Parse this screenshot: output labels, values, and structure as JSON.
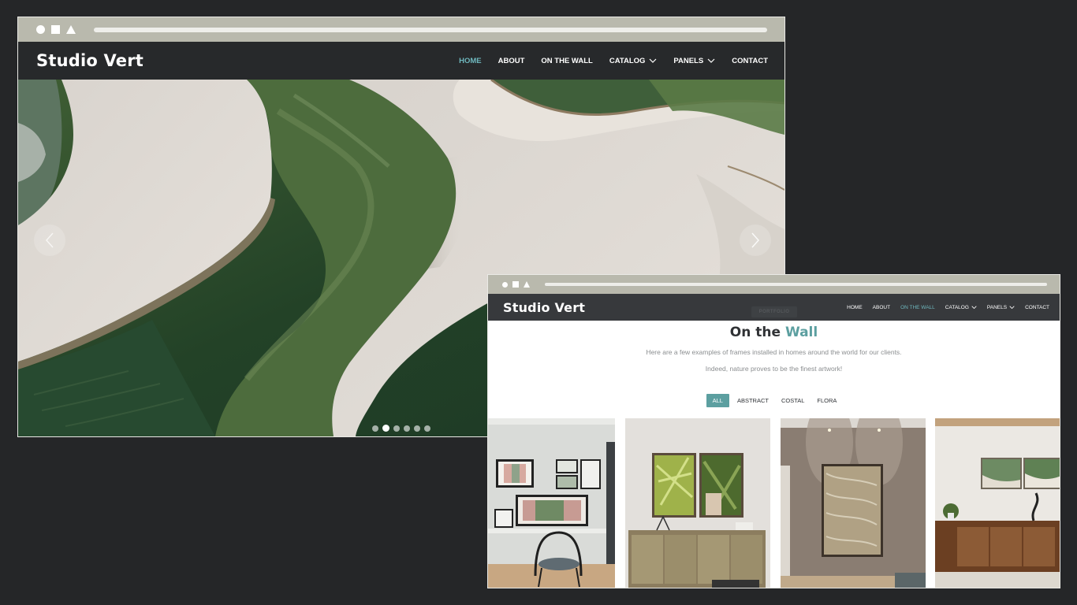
{
  "windows": {
    "home": {
      "site": {
        "logo": "Studio Vert",
        "nav": [
          {
            "label": "HOME",
            "active": true,
            "dropdown": false
          },
          {
            "label": "ABOUT",
            "active": false,
            "dropdown": false
          },
          {
            "label": "ON THE WALL",
            "active": false,
            "dropdown": false
          },
          {
            "label": "CATALOG",
            "active": false,
            "dropdown": true
          },
          {
            "label": "PANELS",
            "active": false,
            "dropdown": true
          },
          {
            "label": "CONTACT",
            "active": false,
            "dropdown": false
          }
        ]
      },
      "hero": {
        "prev_icon": "chevron-left-icon",
        "next_icon": "chevron-right-icon",
        "slide_count": 6,
        "active_slide": 2
      }
    },
    "wall": {
      "site": {
        "logo": "Studio Vert",
        "nav": [
          {
            "label": "HOME",
            "active": false,
            "dropdown": false
          },
          {
            "label": "ABOUT",
            "active": false,
            "dropdown": false
          },
          {
            "label": "ON THE WALL",
            "active": true,
            "dropdown": false
          },
          {
            "label": "CATALOG",
            "active": false,
            "dropdown": true
          },
          {
            "label": "PANELS",
            "active": false,
            "dropdown": true
          },
          {
            "label": "CONTACT",
            "active": false,
            "dropdown": false
          }
        ]
      },
      "section": {
        "tag": "PORTFOLIO",
        "title_lead": "On the",
        "title_accent": "Wall",
        "description_line1": "Here are a few examples of frames installed in homes around the world for our clients.",
        "description_line2": "Indeed, nature proves to be the finest artwork!"
      },
      "filters": [
        {
          "label": "ALL",
          "active": true
        },
        {
          "label": "ABSTRACT",
          "active": false
        },
        {
          "label": "COSTAL",
          "active": false
        },
        {
          "label": "FLORA",
          "active": false
        }
      ]
    }
  },
  "colors": {
    "page_background": "#252628",
    "chrome_bar": "#b9b9ad",
    "nav_background": "#2b2d30",
    "accent": "#5c9fa0",
    "nav_active": "#6fb8be"
  }
}
